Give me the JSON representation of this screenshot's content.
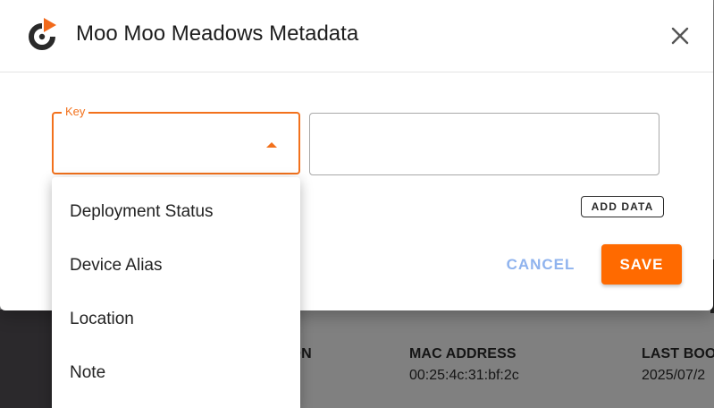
{
  "dialog": {
    "title": "Moo Moo Meadows Metadata",
    "close_icon": "close-icon",
    "logo_icon": "power-play-logo-icon"
  },
  "form": {
    "key_label": "Key",
    "key_value": "",
    "value_input": "",
    "add_data_label": "ADD DATA"
  },
  "menu": {
    "items": [
      {
        "label": "Deployment Status"
      },
      {
        "label": "Device Alias"
      },
      {
        "label": "Location"
      },
      {
        "label": "Note"
      }
    ]
  },
  "actions": {
    "cancel_label": "CANCEL",
    "save_label": "SAVE"
  },
  "background_table": {
    "columns": [
      {
        "header": "ION",
        "value": ""
      },
      {
        "header": "MAC ADDRESS",
        "value": "00:25:4c:31:bf:2c"
      },
      {
        "header": "LAST BOO",
        "value": "2025/07/2"
      }
    ]
  },
  "colors": {
    "accent": "#f2711c",
    "save_bg": "#ff6a00",
    "cancel_text": "#8fb3ee",
    "overlay": "#808080"
  }
}
